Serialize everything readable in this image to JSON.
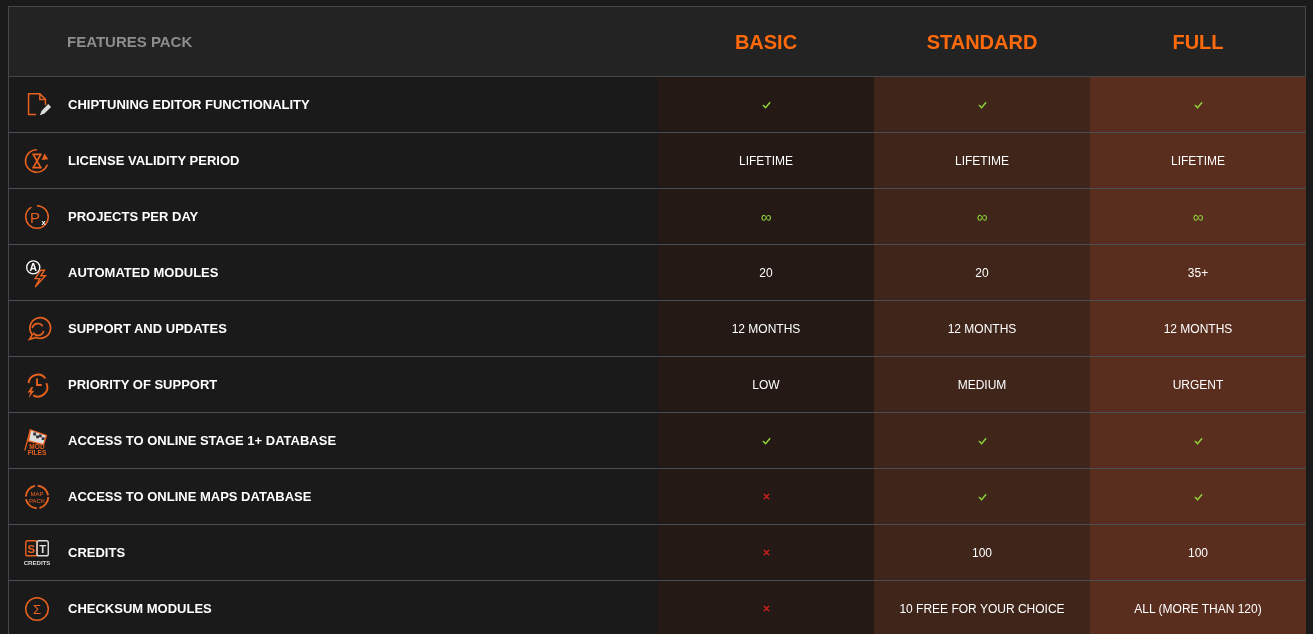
{
  "header": {
    "title": "FEATURES PACK",
    "plans": [
      {
        "name": "BASIC"
      },
      {
        "name": "STANDARD"
      },
      {
        "name": "FULL"
      }
    ]
  },
  "features": [
    {
      "label": "CHIPTUNING EDITOR FUNCTIONALITY",
      "cells": [
        {
          "kind": "check"
        },
        {
          "kind": "check"
        },
        {
          "kind": "check"
        }
      ]
    },
    {
      "label": "LICENSE VALIDITY PERIOD",
      "cells": [
        {
          "kind": "text",
          "text": "LIFETIME"
        },
        {
          "kind": "text",
          "text": "LIFETIME"
        },
        {
          "kind": "text",
          "text": "LIFETIME"
        }
      ]
    },
    {
      "label": "PROJECTS PER DAY",
      "icon_text": [
        "P",
        "x"
      ],
      "cells": [
        {
          "kind": "infinity",
          "text": "∞"
        },
        {
          "kind": "infinity",
          "text": "∞"
        },
        {
          "kind": "infinity",
          "text": "∞"
        }
      ]
    },
    {
      "label": "AUTOMATED MODULES",
      "icon_text": [
        "A"
      ],
      "cells": [
        {
          "kind": "text",
          "text": "20"
        },
        {
          "kind": "text",
          "text": "20"
        },
        {
          "kind": "text",
          "text": "35+"
        }
      ]
    },
    {
      "label": "SUPPORT AND UPDATES",
      "cells": [
        {
          "kind": "text",
          "text": "12 MONTHS"
        },
        {
          "kind": "text",
          "text": "12 MONTHS"
        },
        {
          "kind": "text",
          "text": "12 MONTHS"
        }
      ]
    },
    {
      "label": "PRIORITY OF SUPPORT",
      "cells": [
        {
          "kind": "text",
          "text": "LOW"
        },
        {
          "kind": "text",
          "text": "MEDIUM"
        },
        {
          "kind": "text",
          "text": "URGENT"
        }
      ]
    },
    {
      "label": "ACCESS TO ONLINE STAGE 1+ DATABASE",
      "icon_text": [
        "MOD",
        "FILES"
      ],
      "cells": [
        {
          "kind": "check"
        },
        {
          "kind": "check"
        },
        {
          "kind": "check"
        }
      ]
    },
    {
      "label": "ACCESS TO ONLINE MAPS DATABASE",
      "icon_text": [
        "MAP",
        "PACK"
      ],
      "cells": [
        {
          "kind": "cross"
        },
        {
          "kind": "check"
        },
        {
          "kind": "check"
        }
      ]
    },
    {
      "label": "CREDITS",
      "icon_text": [
        "S",
        "T",
        "CREDITS"
      ],
      "cells": [
        {
          "kind": "cross"
        },
        {
          "kind": "text",
          "text": "100"
        },
        {
          "kind": "text",
          "text": "100"
        }
      ]
    },
    {
      "label": "CHECKSUM MODULES",
      "icon_text": [
        "Σ"
      ],
      "cells": [
        {
          "kind": "cross"
        },
        {
          "kind": "text",
          "text": "10 FREE FOR YOUR CHOICE"
        },
        {
          "kind": "text",
          "text": "ALL (MORE THAN 120)"
        }
      ]
    }
  ]
}
